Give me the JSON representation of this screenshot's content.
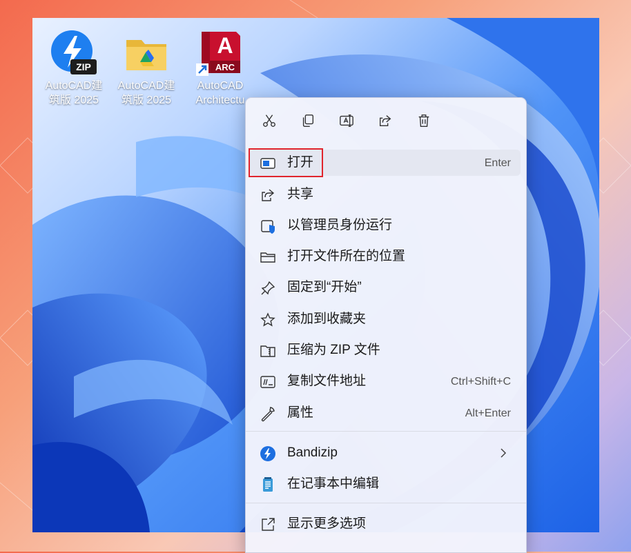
{
  "desktop_icons": [
    {
      "line1": "AutoCAD建",
      "line2": "筑版 2025",
      "icon": "zip-archive-icon",
      "badge": "ZIP"
    },
    {
      "line1": "AutoCAD建",
      "line2": "筑版 2025",
      "icon": "folder-icon"
    },
    {
      "line1": "AutoCAD",
      "line2": "Architectu",
      "icon": "autocad-architecture-icon",
      "logo_letter": "A",
      "badge": "ARC"
    }
  ],
  "toolbar": [
    {
      "name": "cut",
      "icon": "scissors-icon"
    },
    {
      "name": "copy",
      "icon": "copy-icon"
    },
    {
      "name": "rename",
      "icon": "rename-icon"
    },
    {
      "name": "share",
      "icon": "share-icon"
    },
    {
      "name": "delete",
      "icon": "trash-icon"
    }
  ],
  "menu_items": [
    {
      "label": "打开",
      "shortcut": "Enter",
      "icon": "open-window-icon"
    },
    {
      "label": "共享",
      "shortcut": "",
      "icon": "share-icon"
    },
    {
      "label": "以管理员身份运行",
      "shortcut": "",
      "icon": "admin-shield-icon"
    },
    {
      "label": "打开文件所在的位置",
      "shortcut": "",
      "icon": "folder-outline-icon"
    },
    {
      "label": "固定到“开始”",
      "shortcut": "",
      "icon": "pin-icon"
    },
    {
      "label": "添加到收藏夹",
      "shortcut": "",
      "icon": "star-icon"
    },
    {
      "label": "压缩为 ZIP 文件",
      "shortcut": "",
      "icon": "zip-folder-icon"
    },
    {
      "label": "复制文件地址",
      "shortcut": "Ctrl+Shift+C",
      "icon": "copy-path-icon"
    },
    {
      "label": "属性",
      "shortcut": "Alt+Enter",
      "icon": "wrench-icon"
    },
    {
      "label": "Bandizip",
      "shortcut": "",
      "icon": "bandizip-icon",
      "submenu": true
    },
    {
      "label": "在记事本中编辑",
      "shortcut": "",
      "icon": "notepad-icon"
    },
    {
      "label": "显示更多选项",
      "shortcut": "",
      "icon": "more-options-icon"
    }
  ],
  "colors": {
    "accent": "#0f6cd8",
    "highlight_border": "#e0242c",
    "hover_bg": "#e4e7f1"
  }
}
